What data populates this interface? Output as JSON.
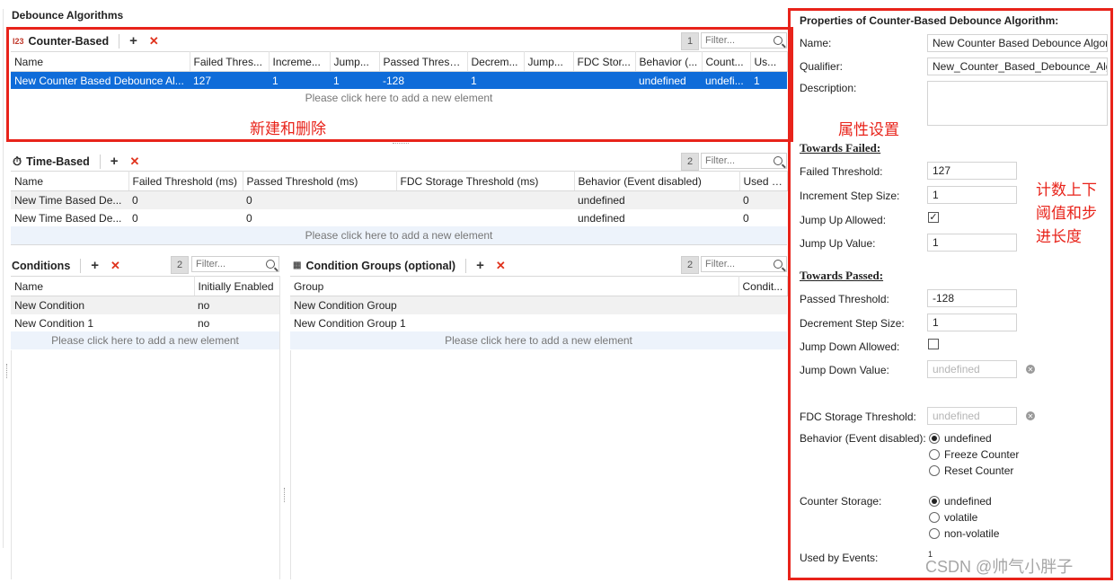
{
  "page": {
    "title": "Debounce Algorithms"
  },
  "counter": {
    "icon": "counter-icon",
    "icon_glyph": "I23",
    "title": "Counter-Based",
    "count": "1",
    "filter_placeholder": "Filter...",
    "columns": [
      "Name",
      "Failed Thres...",
      "Increme...",
      "Jump...",
      "Passed Thresh...",
      "Decrem...",
      "Jump...",
      "FDC Stor...",
      "Behavior (...",
      "Count...",
      "Us..."
    ],
    "rows": [
      [
        "New Counter Based Debounce Al...",
        "127",
        "1",
        "1",
        "-128",
        "1",
        "",
        "",
        "undefined",
        "undefi...",
        "1"
      ]
    ],
    "add_hint": "Please click here to add a new element"
  },
  "time": {
    "icon": "stopwatch-icon",
    "icon_glyph": "⏱",
    "title": "Time-Based",
    "count": "2",
    "filter_placeholder": "Filter...",
    "columns": [
      "Name",
      "Failed Threshold (ms)",
      "Passed Threshold (ms)",
      "FDC Storage Threshold (ms)",
      "Behavior (Event disabled)",
      "Used by"
    ],
    "rows": [
      [
        "New Time Based De...",
        "0",
        "0",
        "",
        "undefined",
        "0"
      ],
      [
        "New Time Based De...",
        "0",
        "0",
        "",
        "undefined",
        "0"
      ]
    ],
    "add_hint": "Please click here to add a new element"
  },
  "conditions": {
    "title": "Conditions",
    "count": "2",
    "filter_placeholder": "Filter...",
    "columns": [
      "Name",
      "Initially Enabled"
    ],
    "rows": [
      [
        "New Condition",
        "no"
      ],
      [
        "New Condition 1",
        "no"
      ]
    ],
    "add_hint": "Please click here to add a new element"
  },
  "groups": {
    "icon": "group-icon",
    "title": "Condition Groups (optional)",
    "count": "2",
    "filter_placeholder": "Filter...",
    "columns": [
      "Group",
      "Condit..."
    ],
    "rows": [
      [
        "New Condition Group",
        ""
      ],
      [
        "New Condition Group 1",
        ""
      ]
    ],
    "add_hint": "Please click here to add a new element"
  },
  "annotations": {
    "create_delete": "新建和删除",
    "properties": "属性设置",
    "counter_note_1": "计数上下",
    "counter_note_2": "阈值和步",
    "counter_note_3": "进长度"
  },
  "props": {
    "title": "Properties of Counter-Based Debounce Algorithm:",
    "name_label": "Name:",
    "name_value": "New Counter Based Debounce Algori",
    "qualifier_label": "Qualifier:",
    "qualifier_value": "New_Counter_Based_Debounce_Algo",
    "description_label": "Description:",
    "towards_failed": "Towards Failed:",
    "failed_threshold_label": "Failed Threshold:",
    "failed_threshold_value": "127",
    "increment_label": "Increment Step Size:",
    "increment_value": "1",
    "jump_up_allowed_label": "Jump Up Allowed:",
    "jump_up_allowed_checked": true,
    "jump_up_value_label": "Jump Up Value:",
    "jump_up_value": "1",
    "towards_passed": "Towards Passed:",
    "passed_threshold_label": "Passed Threshold:",
    "passed_threshold_value": "-128",
    "decrement_label": "Decrement Step Size:",
    "decrement_value": "1",
    "jump_down_allowed_label": "Jump Down Allowed:",
    "jump_down_allowed_checked": false,
    "jump_down_value_label": "Jump Down Value:",
    "jump_down_value": "undefined",
    "fdc_label": "FDC Storage Threshold:",
    "fdc_value": "undefined",
    "behavior_label": "Behavior (Event disabled):",
    "behavior_options": [
      "undefined",
      "Freeze Counter",
      "Reset Counter"
    ],
    "behavior_selected": 0,
    "storage_label": "Counter Storage:",
    "storage_options": [
      "undefined",
      "volatile",
      "non-volatile"
    ],
    "storage_selected": 0,
    "used_by_label": "Used by Events:",
    "used_by_value": "1"
  },
  "watermark": "CSDN @帅气小胖子",
  "colors": {
    "accent": "#e8231a",
    "selection": "#0f6cd9",
    "add_row": "#edf3fb"
  }
}
